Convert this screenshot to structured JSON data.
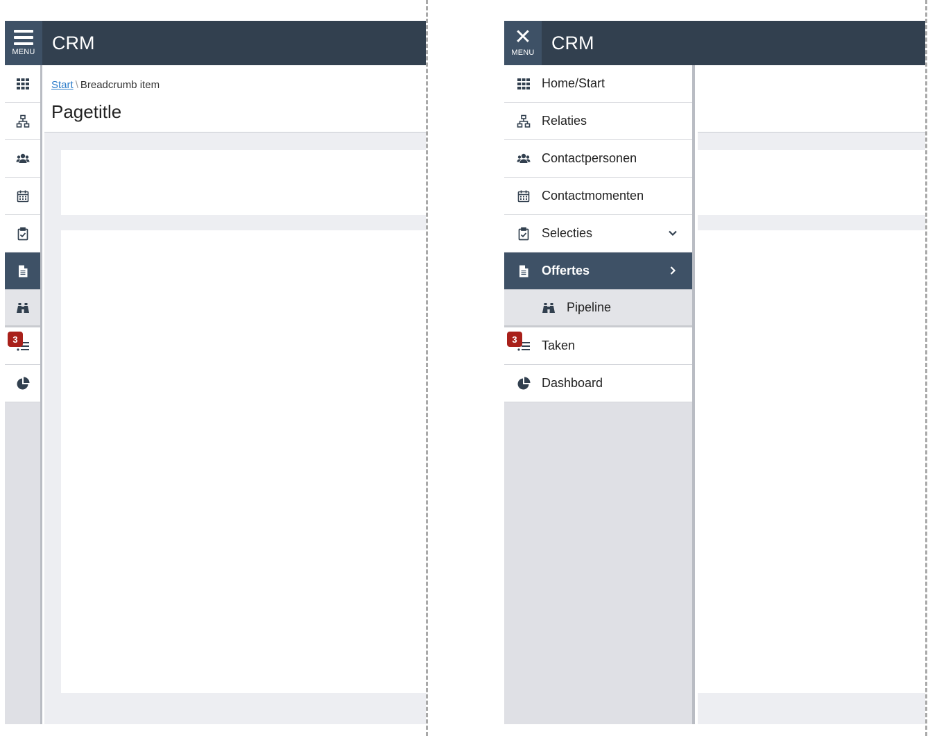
{
  "app": {
    "title": "CRM",
    "menu_label": "MENU"
  },
  "page": {
    "breadcrumb_link": "Start",
    "breadcrumb_sep": "\\",
    "breadcrumb_current": "Breadcrumb item",
    "title": "Pagetitle"
  },
  "nav": {
    "items": [
      {
        "label": "Home/Start",
        "icon": "grid-icon"
      },
      {
        "label": "Relaties",
        "icon": "sitemap-icon"
      },
      {
        "label": "Contactpersonen",
        "icon": "users-icon"
      },
      {
        "label": "Contactmomenten",
        "icon": "calendar-icon"
      },
      {
        "label": "Selecties",
        "icon": "clipboard-check-icon"
      },
      {
        "label": "Offertes",
        "icon": "document-icon"
      },
      {
        "label": "Pipeline",
        "icon": "binoculars-icon"
      },
      {
        "label": "Taken",
        "icon": "task-list-icon",
        "badge": "3"
      },
      {
        "label": "Dashboard",
        "icon": "pie-chart-icon"
      }
    ]
  },
  "colors": {
    "header": "#32404f",
    "active": "#3e5166",
    "badge": "#a8201a",
    "link": "#2b7bc9"
  }
}
